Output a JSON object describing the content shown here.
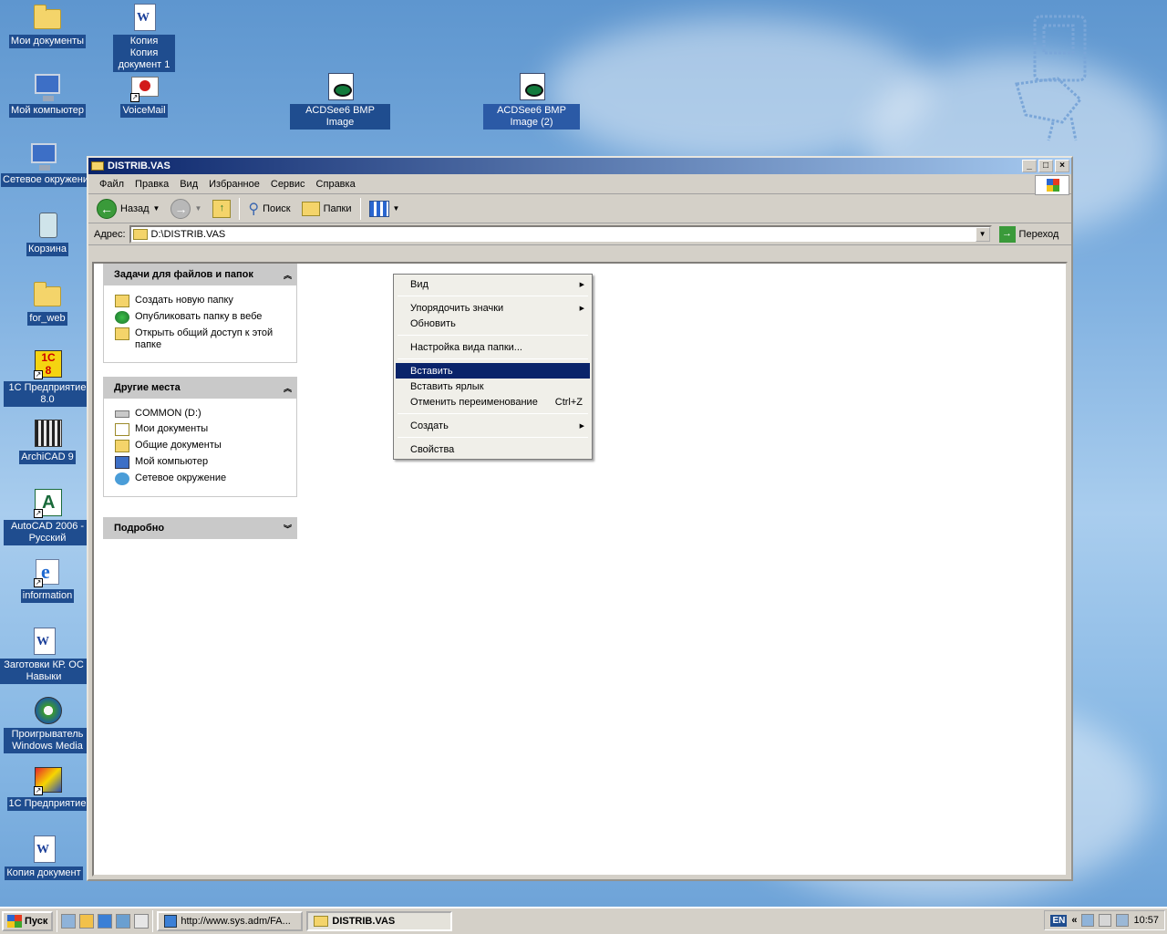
{
  "desktop": {
    "icons": [
      {
        "label": "Мои документы"
      },
      {
        "label": "Копия Копия документ 1"
      },
      {
        "label": "Мой компьютер"
      },
      {
        "label": "VoiceMail"
      },
      {
        "label": "ACDSee6 BMP Image"
      },
      {
        "label": "ACDSee6 BMP Image (2)"
      },
      {
        "label": "Сетевое окружение"
      },
      {
        "label": "Корзина"
      },
      {
        "label": "for_web"
      },
      {
        "label": "1С Предприятие 8.0"
      },
      {
        "label": "ArchiCAD 9"
      },
      {
        "label": "AutoCAD 2006 - Русский"
      },
      {
        "label": "information"
      },
      {
        "label": "Заготовки КР. ОС Навыки"
      },
      {
        "label": "Проигрыватель Windows Media"
      },
      {
        "label": "1С Предприятие"
      },
      {
        "label": "Копия документ"
      }
    ]
  },
  "window": {
    "title": "DISTRIB.VAS",
    "controls": {
      "minimize": "_",
      "maximize": "□",
      "close": "×"
    },
    "menu": [
      "Файл",
      "Правка",
      "Вид",
      "Избранное",
      "Сервис",
      "Справка"
    ],
    "toolbar": {
      "back": "Назад",
      "search": "Поиск",
      "folders": "Папки"
    },
    "address": {
      "label": "Адрес:",
      "value": "D:\\DISTRIB.VAS",
      "go": "Переход"
    }
  },
  "tasks_panel": {
    "title": "Задачи для файлов и папок",
    "items": [
      "Создать новую папку",
      "Опубликовать папку в вебе",
      "Открыть общий доступ к этой папке"
    ]
  },
  "places_panel": {
    "title": "Другие места",
    "items": [
      "COMMON (D:)",
      "Мои документы",
      "Общие документы",
      "Мой компьютер",
      "Сетевое окружение"
    ]
  },
  "details_panel": {
    "title": "Подробно"
  },
  "context_menu": {
    "items": [
      {
        "label": "Вид"
      },
      {
        "label": "Упорядочить значки"
      },
      {
        "label": "Обновить"
      },
      {
        "label": "Настройка вида папки..."
      },
      {
        "label": "Вставить"
      },
      {
        "label": "Вставить ярлык"
      },
      {
        "label": "Отменить переименование",
        "shortcut": "Ctrl+Z"
      },
      {
        "label": "Создать"
      },
      {
        "label": "Свойства"
      }
    ]
  },
  "taskbar": {
    "start": "Пуск",
    "tasks": [
      "http://www.sys.adm/FA...",
      "DISTRIB.VAS"
    ],
    "lang": "EN",
    "tray_arrow": "«",
    "clock": "10:57"
  }
}
